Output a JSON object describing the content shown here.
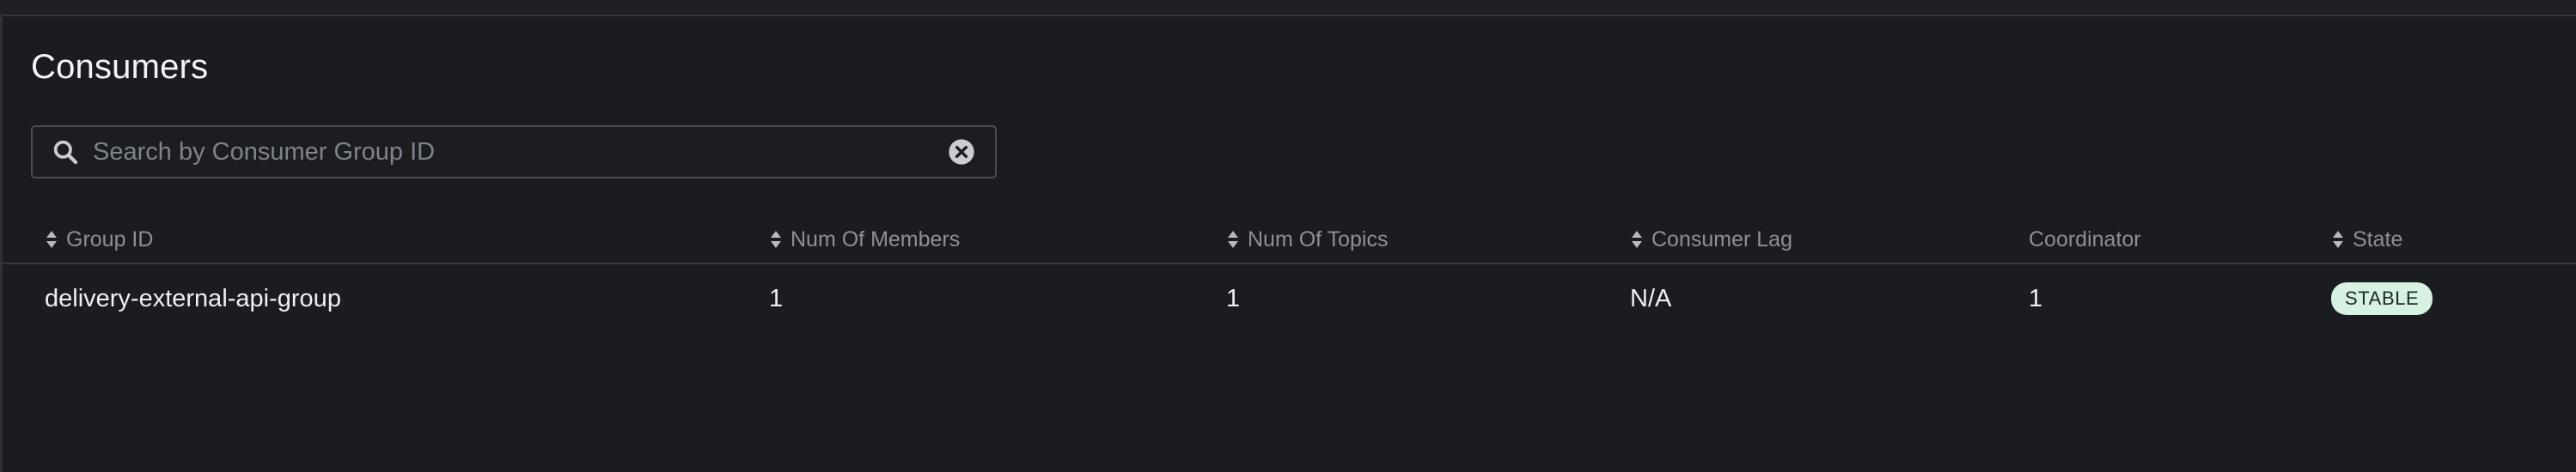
{
  "page": {
    "title": "Consumers"
  },
  "search": {
    "placeholder": "Search by Consumer Group ID",
    "value": ""
  },
  "table": {
    "columns": [
      {
        "label": "Group ID",
        "sortable": true
      },
      {
        "label": "Num Of Members",
        "sortable": true
      },
      {
        "label": "Num Of Topics",
        "sortable": true
      },
      {
        "label": "Consumer Lag",
        "sortable": true
      },
      {
        "label": "Coordinator",
        "sortable": false
      },
      {
        "label": "State",
        "sortable": true
      }
    ],
    "rows": [
      {
        "group_id": "delivery-external-api-group",
        "num_members": "1",
        "num_topics": "1",
        "consumer_lag": "N/A",
        "coordinator": "1",
        "state": "STABLE"
      }
    ]
  },
  "icons": {
    "search": "search-icon",
    "clear": "clear-icon",
    "sort": "sort-icon"
  },
  "colors": {
    "background": "#1a1c1f",
    "text": "#eef0f3",
    "muted": "#8c9199",
    "badge_bg": "#d7f1e2",
    "badge_text": "#1d2b22"
  }
}
